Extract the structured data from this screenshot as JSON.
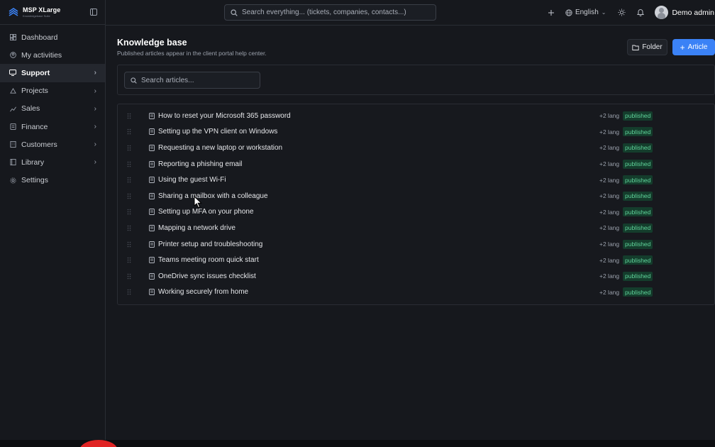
{
  "brand": {
    "name": "MSP XLarge",
    "subtitle": "Knowledgebase Suite"
  },
  "sidebar": {
    "items": [
      {
        "label": "Dashboard",
        "icon": "dashboard-icon",
        "chevron": false,
        "active": false
      },
      {
        "label": "My activities",
        "icon": "user-circle-icon",
        "chevron": false,
        "active": false
      },
      {
        "label": "Support",
        "icon": "support-icon",
        "chevron": true,
        "active": true
      },
      {
        "label": "Projects",
        "icon": "projects-icon",
        "chevron": true,
        "active": false
      },
      {
        "label": "Sales",
        "icon": "chart-icon",
        "chevron": true,
        "active": false
      },
      {
        "label": "Finance",
        "icon": "finance-icon",
        "chevron": true,
        "active": false
      },
      {
        "label": "Customers",
        "icon": "customers-icon",
        "chevron": true,
        "active": false
      },
      {
        "label": "Library",
        "icon": "library-icon",
        "chevron": true,
        "active": false
      },
      {
        "label": "Settings",
        "icon": "gear-icon",
        "chevron": false,
        "active": false
      }
    ]
  },
  "topbar": {
    "search_placeholder": "Search everything... (tickets, companies, contacts...)",
    "language": "English",
    "user_name": "Demo admin"
  },
  "page": {
    "title": "Knowledge base",
    "subtitle": "Published articles appear in the client portal help center.",
    "folder_button": "Folder",
    "article_button": "Article",
    "article_search_placeholder": "Search articles..."
  },
  "articles": [
    {
      "title": "How to reset your Microsoft 365 password",
      "langs": "+2 lang",
      "status": "published"
    },
    {
      "title": "Setting up the VPN client on Windows",
      "langs": "+2 lang",
      "status": "published"
    },
    {
      "title": "Requesting a new laptop or workstation",
      "langs": "+2 lang",
      "status": "published"
    },
    {
      "title": "Reporting a phishing email",
      "langs": "+2 lang",
      "status": "published"
    },
    {
      "title": "Using the guest Wi-Fi",
      "langs": "+2 lang",
      "status": "published"
    },
    {
      "title": "Sharing a mailbox with a colleague",
      "langs": "+2 lang",
      "status": "published"
    },
    {
      "title": "Setting up MFA on your phone",
      "langs": "+2 lang",
      "status": "published"
    },
    {
      "title": "Mapping a network drive",
      "langs": "+2 lang",
      "status": "published"
    },
    {
      "title": "Printer setup and troubleshooting",
      "langs": "+2 lang",
      "status": "published"
    },
    {
      "title": "Teams meeting room quick start",
      "langs": "+2 lang",
      "status": "published"
    },
    {
      "title": "OneDrive sync issues checklist",
      "langs": "+2 lang",
      "status": "published"
    },
    {
      "title": "Working securely from home",
      "langs": "+2 lang",
      "status": "published"
    }
  ],
  "colors": {
    "accent": "#3b82f6",
    "background": "#16181d",
    "badge_bg": "#143d2c",
    "badge_text": "#5fd39a"
  }
}
